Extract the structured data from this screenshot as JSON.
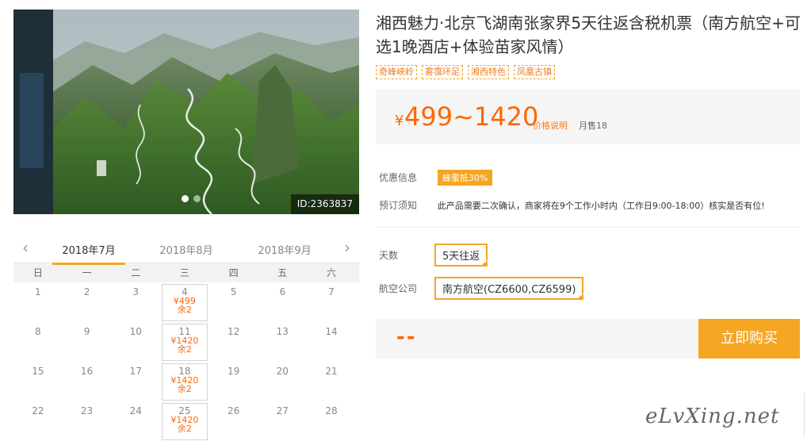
{
  "hero": {
    "image_id": "ID:2363837",
    "dots": 2,
    "active_dot": 0
  },
  "calendar": {
    "prev_label": "‹",
    "next_label": "›",
    "months": [
      "2018年7月",
      "2018年8月",
      "2018年9月"
    ],
    "active_month": 0,
    "weekdays": [
      "日",
      "一",
      "二",
      "三",
      "四",
      "五",
      "六"
    ],
    "weeks": [
      [
        {
          "d": "1"
        },
        {
          "d": "2"
        },
        {
          "d": "3"
        },
        {
          "d": "4",
          "price": "¥499",
          "stock": "余2"
        },
        {
          "d": "5"
        },
        {
          "d": "6"
        },
        {
          "d": "7"
        }
      ],
      [
        {
          "d": "8"
        },
        {
          "d": "9"
        },
        {
          "d": "10"
        },
        {
          "d": "11",
          "price": "¥1420",
          "stock": "余2"
        },
        {
          "d": "12"
        },
        {
          "d": "13"
        },
        {
          "d": "14"
        }
      ],
      [
        {
          "d": "15"
        },
        {
          "d": "16"
        },
        {
          "d": "17"
        },
        {
          "d": "18",
          "price": "¥1420",
          "stock": "余2"
        },
        {
          "d": "19"
        },
        {
          "d": "20"
        },
        {
          "d": "21"
        }
      ],
      [
        {
          "d": "22"
        },
        {
          "d": "23"
        },
        {
          "d": "24"
        },
        {
          "d": "25",
          "price": "¥1420",
          "stock": "余2"
        },
        {
          "d": "26"
        },
        {
          "d": "27"
        },
        {
          "d": "28"
        }
      ]
    ]
  },
  "product": {
    "title": "湘西魅力·北京飞湖南张家界5天往返含税机票（南方航空+可选1晚酒店+体验苗家风情）",
    "tags": [
      "奇峰峡岭",
      "雾霭环足",
      "湘西特色",
      "凤凰古镇"
    ],
    "currency": "¥",
    "price_range": "499~1420",
    "price_explain": "价格说明",
    "monthly_sales": "月售18"
  },
  "info": {
    "promo_label": "优惠信息",
    "promo_value": "蜂蜜抵30%",
    "notice_label": "预订须知",
    "notice_text": "此产品需要二次确认，商家将在9个工作小时内（工作日9:00-18:00）核实是否有位!"
  },
  "options": {
    "days_label": "天数",
    "days_value": "5天往返",
    "airline_label": "航空公司",
    "airline_value": "南方航空(CZ6600,CZ6599)"
  },
  "purchase": {
    "total": "--",
    "buy_label": "立即购买"
  },
  "watermark": "eLvXing.net",
  "colors": {
    "accent": "#f5a623",
    "price": "#ff6600",
    "panel_bg": "#f5f5f5"
  }
}
